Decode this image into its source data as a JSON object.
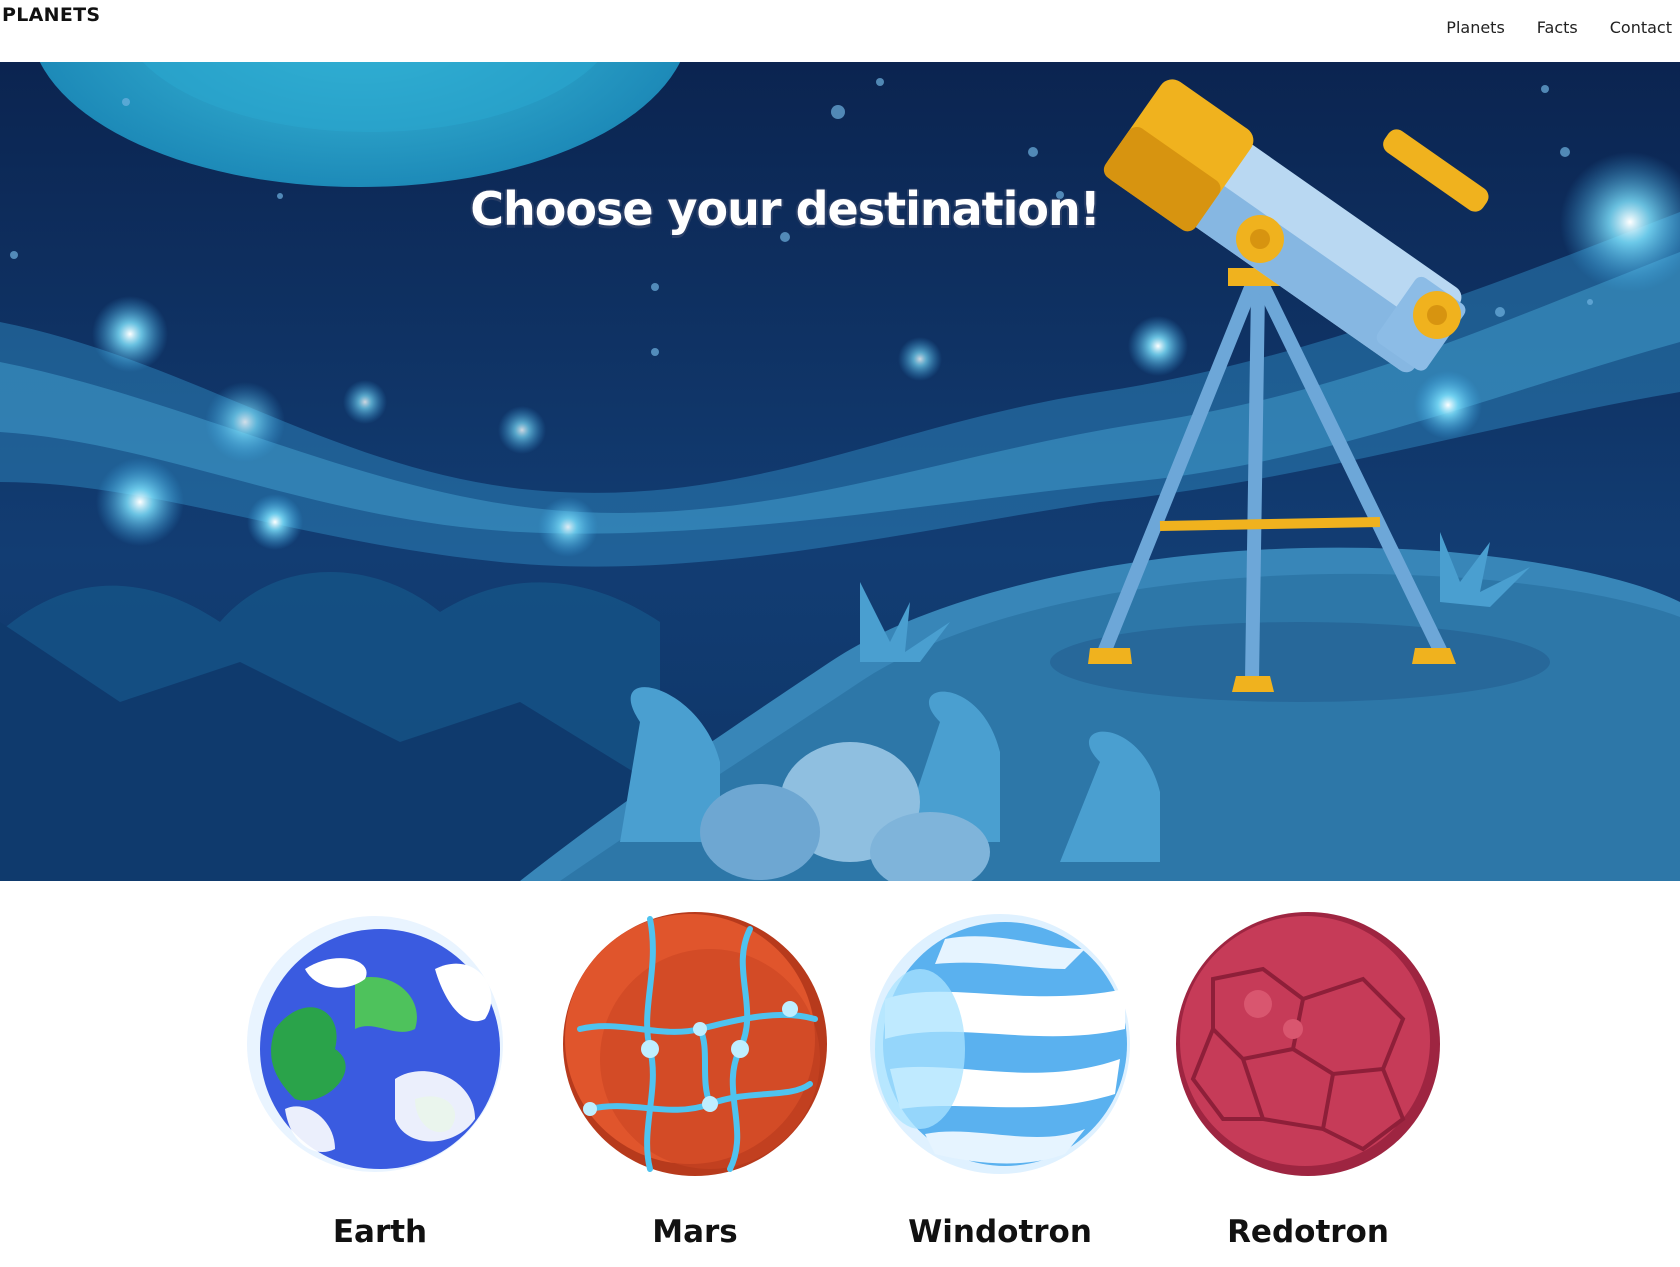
{
  "header": {
    "logo": "PLANETS",
    "nav": [
      "Planets",
      "Facts",
      "Contact"
    ]
  },
  "hero": {
    "title": "Choose your destination!"
  },
  "planets": [
    {
      "name": "Earth"
    },
    {
      "name": "Mars"
    },
    {
      "name": "Windotron"
    },
    {
      "name": "Redotron"
    }
  ],
  "colors": {
    "sky_dark": "#0d2b5a",
    "sky_mid": "#1c5a8f",
    "hill": "#3a8fbe",
    "telescope_gold": "#f0b21e",
    "telescope_body": "#b9d8f2"
  }
}
